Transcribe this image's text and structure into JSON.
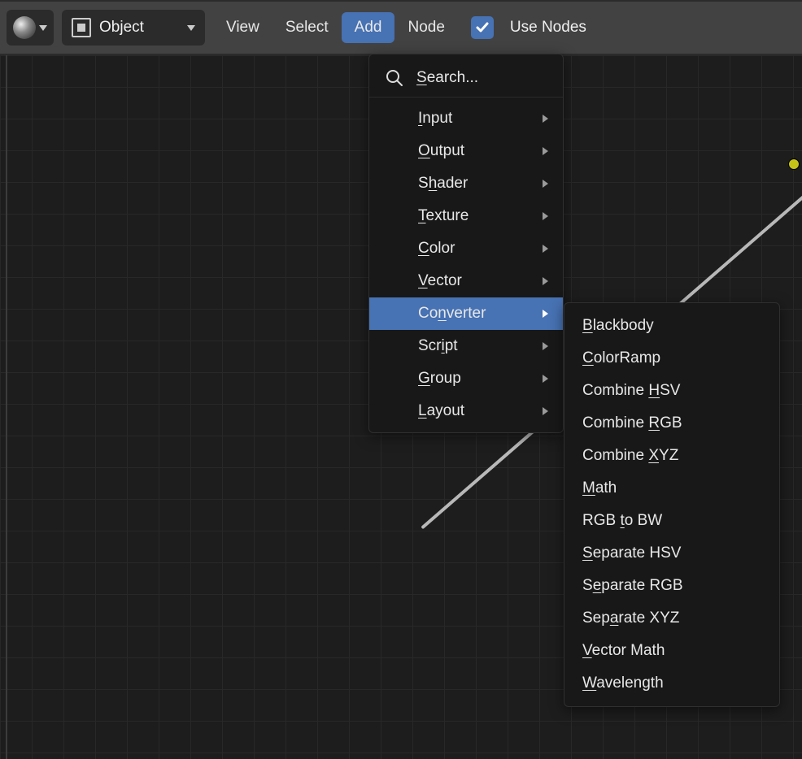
{
  "header": {
    "mode_label": "Object",
    "menu": {
      "view": "View",
      "select": "Select",
      "add": "Add",
      "node": "Node"
    },
    "use_nodes_label": "Use Nodes",
    "use_nodes_checked": true
  },
  "add_menu": {
    "search_placeholder": "Search...",
    "items": [
      {
        "label": "Input",
        "accel": "I",
        "rest": "nput"
      },
      {
        "label": "Output",
        "accel": "O",
        "rest": "utput"
      },
      {
        "label": "Shader",
        "accel": "h",
        "pre": "S",
        "rest": "ader"
      },
      {
        "label": "Texture",
        "accel": "T",
        "rest": "exture"
      },
      {
        "label": "Color",
        "accel": "C",
        "rest": "olor"
      },
      {
        "label": "Vector",
        "accel": "V",
        "rest": "ector"
      },
      {
        "label": "Converter",
        "accel": "n",
        "pre": "Co",
        "rest": "verter",
        "highlighted": true
      },
      {
        "label": "Script",
        "accel": "i",
        "pre": "Scr",
        "rest": "pt"
      },
      {
        "label": "Group",
        "accel": "G",
        "rest": "roup"
      },
      {
        "label": "Layout",
        "accel": "L",
        "rest": "ayout"
      }
    ]
  },
  "converter_submenu": [
    {
      "pre": "",
      "accel": "B",
      "rest": "lackbody"
    },
    {
      "pre": "",
      "accel": "C",
      "rest": "olorRamp"
    },
    {
      "pre": "Combine ",
      "accel": "H",
      "rest": "SV"
    },
    {
      "pre": "Combine ",
      "accel": "R",
      "rest": "GB"
    },
    {
      "pre": "Combine ",
      "accel": "X",
      "rest": "YZ"
    },
    {
      "pre": "",
      "accel": "M",
      "rest": "ath"
    },
    {
      "pre": "RGB ",
      "accel": "t",
      "rest": "o BW"
    },
    {
      "pre": "",
      "accel": "S",
      "rest": "eparate HSV"
    },
    {
      "pre": "S",
      "accel": "e",
      "rest": "parate RGB"
    },
    {
      "pre": "Sep",
      "accel": "a",
      "rest": "rate XYZ"
    },
    {
      "pre": "",
      "accel": "V",
      "rest": "ector Math"
    },
    {
      "pre": "",
      "accel": "W",
      "rest": "avelength"
    }
  ]
}
